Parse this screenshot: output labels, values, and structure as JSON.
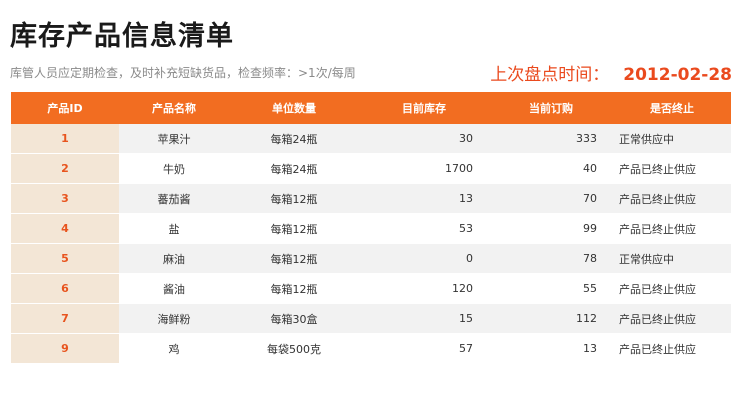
{
  "title": "库存产品信息清单",
  "subtitle": "库管人员应定期检查，及时补充短缺货品，检查频率：>1次/每周",
  "last_check_label": "上次盘点时间：",
  "last_check_date": "2012-02-28",
  "colors": {
    "header": "#f26d21",
    "accent": "#ea4a1e",
    "id_cell": "#f3e6d6"
  },
  "columns": [
    "产品ID",
    "产品名称",
    "单位数量",
    "目前库存",
    "当前订购",
    "是否终止"
  ],
  "rows": [
    {
      "id": "1",
      "name": "苹果汁",
      "unit": "每箱24瓶",
      "stock": "30",
      "ordered": "333",
      "status": "正常供应中"
    },
    {
      "id": "2",
      "name": "牛奶",
      "unit": "每箱24瓶",
      "stock": "1700",
      "ordered": "40",
      "status": "产品已终止供应"
    },
    {
      "id": "3",
      "name": "蕃茄酱",
      "unit": "每箱12瓶",
      "stock": "13",
      "ordered": "70",
      "status": "产品已终止供应"
    },
    {
      "id": "4",
      "name": "盐",
      "unit": "每箱12瓶",
      "stock": "53",
      "ordered": "99",
      "status": "产品已终止供应"
    },
    {
      "id": "5",
      "name": "麻油",
      "unit": "每箱12瓶",
      "stock": "0",
      "ordered": "78",
      "status": "正常供应中"
    },
    {
      "id": "6",
      "name": "酱油",
      "unit": "每箱12瓶",
      "stock": "120",
      "ordered": "55",
      "status": "产品已终止供应"
    },
    {
      "id": "7",
      "name": "海鲜粉",
      "unit": "每箱30盒",
      "stock": "15",
      "ordered": "112",
      "status": "产品已终止供应"
    },
    {
      "id": "9",
      "name": "鸡",
      "unit": "每袋500克",
      "stock": "57",
      "ordered": "13",
      "status": "产品已终止供应"
    }
  ]
}
